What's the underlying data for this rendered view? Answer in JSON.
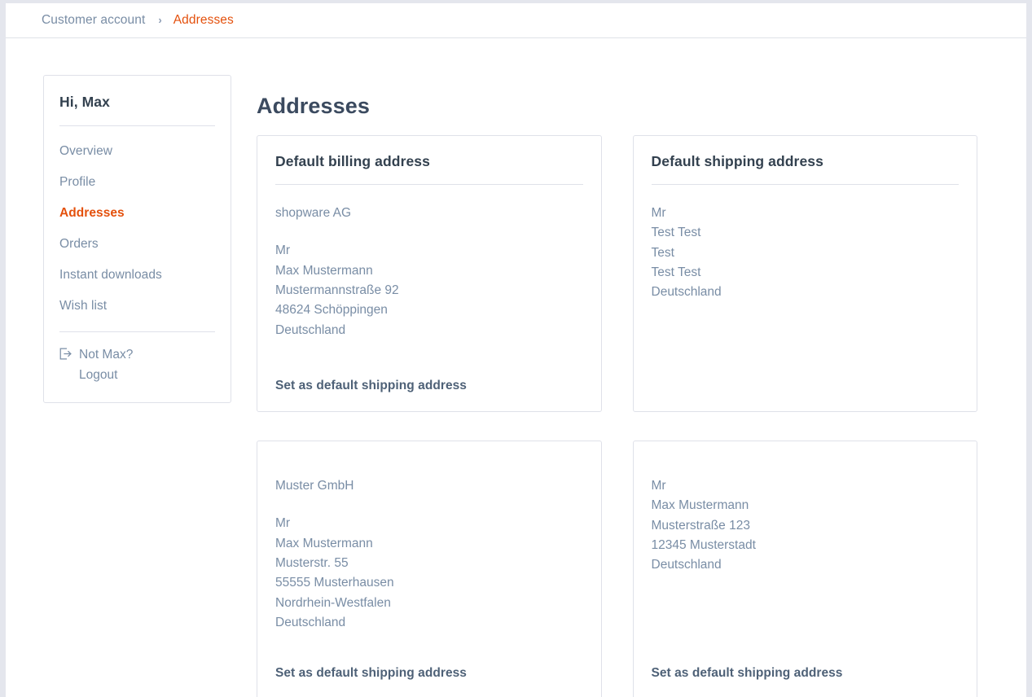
{
  "breadcrumb": {
    "root_label": "Customer account",
    "separator": "›",
    "current_label": "Addresses"
  },
  "sidebar": {
    "greeting": "Hi, Max",
    "items": [
      {
        "label": "Overview",
        "active": false
      },
      {
        "label": "Profile",
        "active": false
      },
      {
        "label": "Addresses",
        "active": true
      },
      {
        "label": "Orders",
        "active": false
      },
      {
        "label": "Instant downloads",
        "active": false
      },
      {
        "label": "Wish list",
        "active": false
      }
    ],
    "logout": {
      "icon": "sign-out-icon",
      "question": "Not Max?",
      "link_label": "Logout"
    }
  },
  "main": {
    "page_title": "Addresses",
    "cards": [
      {
        "title": "Default billing address",
        "company": "shopware AG",
        "lines": [
          "Mr",
          "Max Mustermann",
          "Mustermannstraße 92",
          "48624 Schöppingen",
          "Deutschland"
        ],
        "action_label": "Set as default shipping address"
      },
      {
        "title": "Default shipping address",
        "company": "",
        "lines": [
          "Mr",
          "Test Test",
          "Test",
          "Test Test",
          "Deutschland"
        ],
        "action_label": ""
      },
      {
        "title": "",
        "company": "Muster GmbH",
        "lines": [
          "Mr",
          "Max Mustermann",
          "Musterstr. 55",
          "55555 Musterhausen",
          "Nordrhein-Westfalen",
          "Deutschland"
        ],
        "action_label": "Set as default shipping address"
      },
      {
        "title": "",
        "company": "",
        "lines": [
          "Mr",
          "Max Mustermann",
          "Musterstraße 123",
          "12345 Musterstadt",
          "Deutschland"
        ],
        "action_label": "Set as default shipping address"
      }
    ]
  },
  "colors": {
    "accent": "#e4510d",
    "heading": "#33414f",
    "body_text": "#798da5",
    "border": "#dfe1e9",
    "page_background": "#e4e6ed"
  }
}
